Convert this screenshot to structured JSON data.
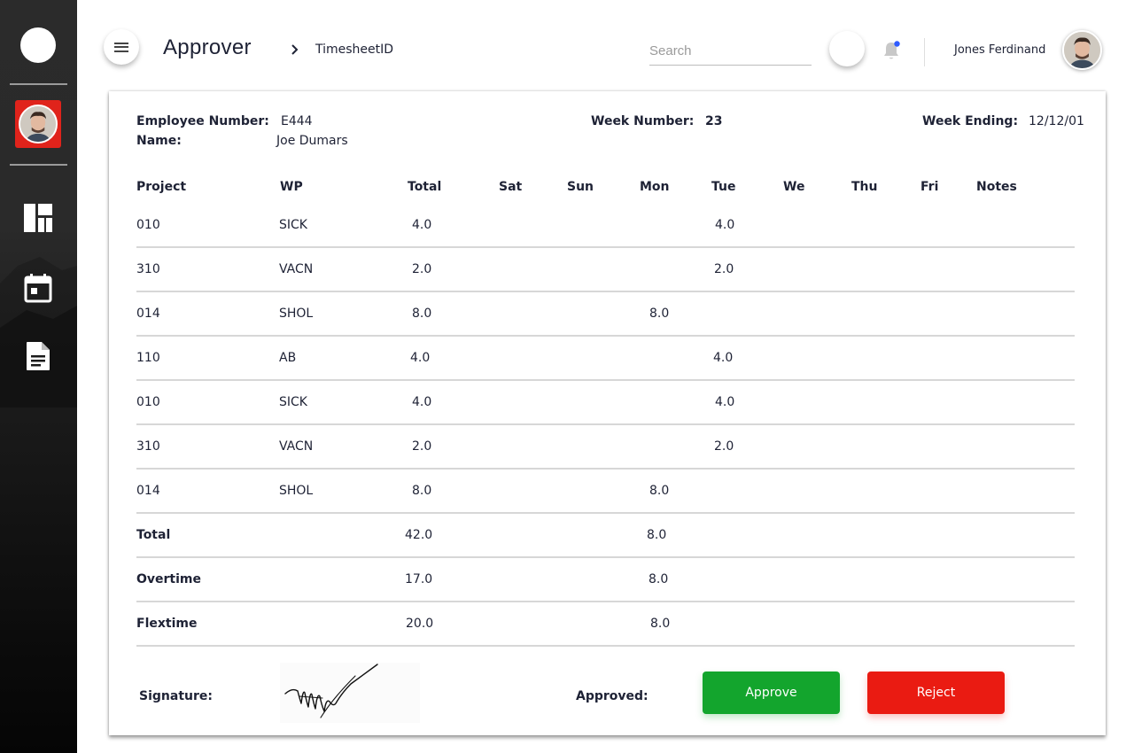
{
  "header": {
    "title": "Approver",
    "breadcrumb": "TimesheetID",
    "search_placeholder": "Search",
    "user_name": "Jones Ferdinand",
    "notification_dot_color": "#2f5bff"
  },
  "sidebar": {
    "items": [
      {
        "icon": "dashboard-icon"
      },
      {
        "icon": "calendar-icon"
      },
      {
        "icon": "document-icon"
      }
    ],
    "active_color": "#e0231b"
  },
  "employee": {
    "number_label": "Employee Number:",
    "number": "E444",
    "name_label": "Name:",
    "name": "Joe Dumars",
    "week_number_label": "Week Number:",
    "week_number": "23",
    "week_ending_label": "Week Ending:",
    "week_ending": "12/12/01"
  },
  "table": {
    "headers": [
      "Project",
      "WP",
      "Total",
      "Sat",
      "Sun",
      "Mon",
      "Tue",
      "We",
      "Thu",
      "Fri",
      "Notes"
    ],
    "rows": [
      {
        "project": "010",
        "wp": "SICK",
        "total": "4.0",
        "mon": "",
        "tue": "4.0"
      },
      {
        "project": "310",
        "wp": "VACN",
        "total": "2.0",
        "mon": "",
        "tue": "2.0"
      },
      {
        "project": "014",
        "wp": "SHOL",
        "total": "8.0",
        "mon": "8.0",
        "tue": ""
      },
      {
        "project": "110",
        "wp": "AB",
        "total": "4.0",
        "mon": "",
        "tue": "4.0"
      },
      {
        "project": "010",
        "wp": "SICK",
        "total": "4.0",
        "mon": "",
        "tue": "4.0"
      },
      {
        "project": "310",
        "wp": "VACN",
        "total": "2.0",
        "mon": "",
        "tue": "2.0"
      },
      {
        "project": "014",
        "wp": "SHOL",
        "total": "8.0",
        "mon": "8.0",
        "tue": ""
      }
    ],
    "summary": [
      {
        "label": "Total",
        "total": "42.0",
        "mon": "8.0"
      },
      {
        "label": "Overtime",
        "total": "17.0",
        "mon": "8.0"
      },
      {
        "label": "Flextime",
        "total": "20.0",
        "mon": "8.0"
      }
    ]
  },
  "footer": {
    "signature_label": "Signature:",
    "approved_label": "Approved:",
    "approve_button": "Approve",
    "reject_button": "Reject",
    "approve_color": "#13a52d",
    "reject_color": "#ea1b12"
  }
}
